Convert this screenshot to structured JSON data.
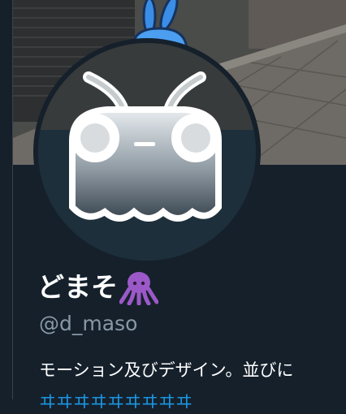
{
  "profile": {
    "display_name": "どまそ",
    "handle": "@d_maso",
    "bio": "モーション及びデザイン。並びに",
    "link_text": "ヰヰヰヰヰヰヰヰヰ"
  },
  "colors": {
    "background": "#15202b",
    "text": "#ffffff",
    "secondary_text": "#8899a6",
    "link": "#1b95e0",
    "octopus": "#9b59c8"
  },
  "icons": {
    "name_emoji": "octopus-icon",
    "avatar": "mascot-avatar-icon"
  }
}
